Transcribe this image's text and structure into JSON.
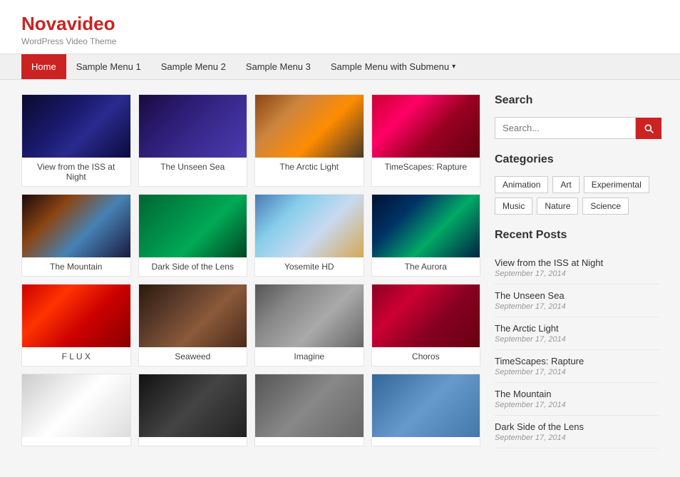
{
  "site": {
    "title": "Novavideo",
    "tagline": "WordPress Video Theme"
  },
  "nav": {
    "items": [
      {
        "label": "Home",
        "active": true
      },
      {
        "label": "Sample Menu 1",
        "active": false
      },
      {
        "label": "Sample Menu 2",
        "active": false
      },
      {
        "label": "Sample Menu 3",
        "active": false
      },
      {
        "label": "Sample Menu with Submenu",
        "active": false,
        "hasSubmenu": true
      }
    ]
  },
  "grid": {
    "items": [
      {
        "title": "View from the ISS at Night",
        "thumbClass": "thumb-iss"
      },
      {
        "title": "The Unseen Sea",
        "thumbClass": "thumb-sea"
      },
      {
        "title": "The Arctic Light",
        "thumbClass": "thumb-arctic"
      },
      {
        "title": "TimeScapes: Rapture",
        "thumbClass": "thumb-rapture"
      },
      {
        "title": "The Mountain",
        "thumbClass": "thumb-mountain"
      },
      {
        "title": "Dark Side of the Lens",
        "thumbClass": "thumb-darklens"
      },
      {
        "title": "Yosemite HD",
        "thumbClass": "thumb-yosemite"
      },
      {
        "title": "The Aurora",
        "thumbClass": "thumb-aurora"
      },
      {
        "title": "F L U X",
        "thumbClass": "thumb-flux"
      },
      {
        "title": "Seaweed",
        "thumbClass": "thumb-seaweed"
      },
      {
        "title": "Imagine",
        "thumbClass": "thumb-imagine"
      },
      {
        "title": "Choros",
        "thumbClass": "thumb-choros"
      },
      {
        "title": "",
        "thumbClass": "thumb-r1"
      },
      {
        "title": "",
        "thumbClass": "thumb-r2"
      },
      {
        "title": "",
        "thumbClass": "thumb-r3"
      },
      {
        "title": "",
        "thumbClass": "thumb-r4"
      }
    ]
  },
  "sidebar": {
    "search": {
      "title": "Search",
      "label": "Search",
      "placeholder": "Search...",
      "button_aria": "search-submit"
    },
    "categories": {
      "title": "Categories",
      "items": [
        "Animation",
        "Art",
        "Experimental",
        "Music",
        "Nature",
        "Science"
      ]
    },
    "recentPosts": {
      "title": "Recent Posts",
      "items": [
        {
          "title": "View from the ISS at Night",
          "date": "September 17, 2014"
        },
        {
          "title": "The Unseen Sea",
          "date": "September 17, 2014"
        },
        {
          "title": "The Arctic Light",
          "date": "September 17, 2014"
        },
        {
          "title": "TimeScapes: Rapture",
          "date": "September 17, 2014"
        },
        {
          "title": "The Mountain",
          "date": "September 17, 2014"
        },
        {
          "title": "Dark Side of the Lens",
          "date": "September 17, 2014"
        }
      ]
    }
  }
}
